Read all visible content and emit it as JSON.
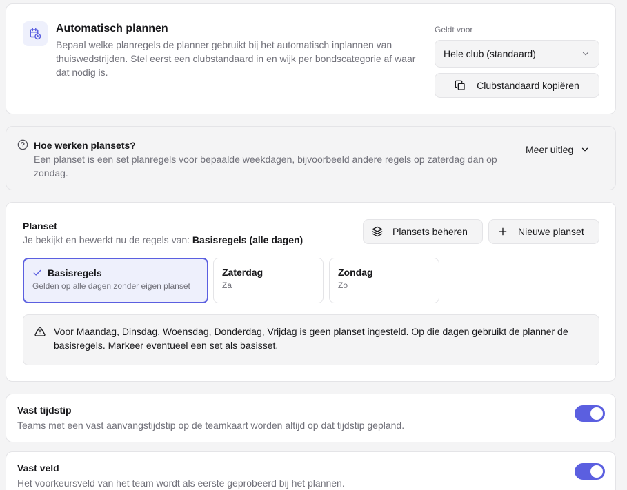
{
  "header": {
    "title": "Automatisch plannen",
    "description": "Bepaal welke planregels de planner gebruikt bij het automatisch inplannen van thuiswedstrijden. Stel eerst een clubstandaard in en wijk per bondscategorie af waar dat nodig is.",
    "scope_label": "Geldt voor",
    "scope_value": "Hele club (standaard)",
    "copy_button": "Clubstandaard kopiëren"
  },
  "help": {
    "title": "Hoe werken plansets?",
    "description": "Een planset is een set planregels voor bepaalde weekdagen, bijvoorbeeld andere regels op zaterdag dan op zondag.",
    "more_label": "Meer uitleg"
  },
  "planset": {
    "title": "Planset",
    "viewing_prefix": "Je bekijkt en bewerkt nu de regels van:",
    "viewing_name": "Basisregels (alle dagen)",
    "manage_button": "Plansets beheren",
    "new_button": "Nieuwe planset",
    "tiles": [
      {
        "name": "Basisregels",
        "sub": "Gelden op alle dagen zonder eigen planset",
        "active": true
      },
      {
        "name": "Zaterdag",
        "sub": "Za",
        "active": false
      },
      {
        "name": "Zondag",
        "sub": "Zo",
        "active": false
      }
    ],
    "warning": "Voor Maandag, Dinsdag, Woensdag, Donderdag, Vrijdag is geen planset ingesteld. Op die dagen gebruikt de planner de basisregels. Markeer eventueel een set als basisset."
  },
  "rules": [
    {
      "title": "Vast tijdstip",
      "description": "Teams met een vast aanvangstijdstip op de teamkaart worden altijd op dat tijdstip gepland.",
      "enabled": true
    },
    {
      "title": "Vast veld",
      "description": "Het voorkeursveld van het team wordt als eerste geprobeerd bij het plannen.",
      "enabled": true
    }
  ],
  "colors": {
    "accent": "#5b5fe0",
    "accent_soft": "#eef0fc",
    "muted_text": "#71717a"
  }
}
